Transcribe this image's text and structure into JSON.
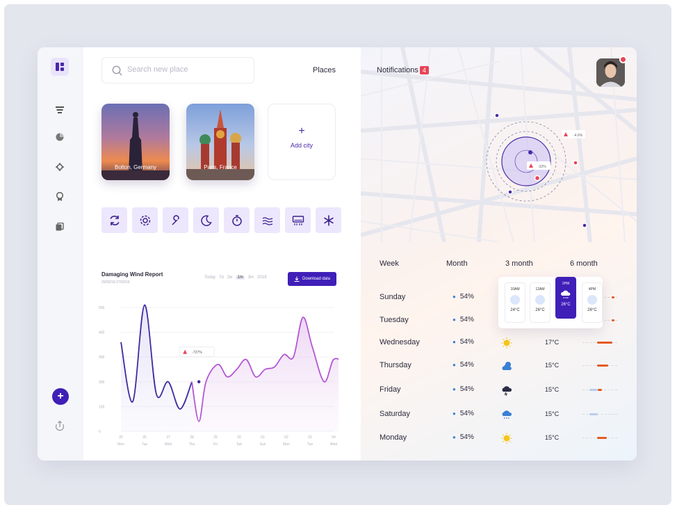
{
  "search": {
    "placeholder": "Search new place"
  },
  "header": {
    "places": "Places",
    "notifications": "Notifications",
    "notification_count": "4"
  },
  "cities": [
    {
      "label": "Bolton, Germany"
    },
    {
      "label": "Paris, France"
    }
  ],
  "add_city": {
    "plus": "+",
    "label": "Add city"
  },
  "tools": [
    "refresh-icon",
    "settings-icon",
    "wrench-icon",
    "moon-icon",
    "timer-icon",
    "wind-icon",
    "ac-icon",
    "snowflake-icon"
  ],
  "report": {
    "title": "Damaging Wind Report",
    "date": "20/02/19-27/02/19",
    "ranges": [
      "Today",
      "7d",
      "2w",
      "1m",
      "3m",
      "2019"
    ],
    "active_range": "1m",
    "download": "Download data"
  },
  "map_alerts": [
    "-4.6%",
    "-32%"
  ],
  "forecast": {
    "tabs": [
      "Week",
      "Month",
      "3 month",
      "6 month"
    ],
    "days": [
      {
        "day": "Sunday",
        "humidity": "54%",
        "icon": "",
        "temp": ""
      },
      {
        "day": "Tuesday",
        "humidity": "54%",
        "icon": "",
        "temp": ""
      },
      {
        "day": "Wednesday",
        "humidity": "54%",
        "icon": "sun-icon",
        "temp": "17°C"
      },
      {
        "day": "Thursday",
        "humidity": "54%",
        "icon": "cloud-sun-icon",
        "temp": "15°C"
      },
      {
        "day": "Friday",
        "humidity": "54%",
        "icon": "storm-icon",
        "temp": "15°C"
      },
      {
        "day": "Saturday",
        "humidity": "54%",
        "icon": "rain-icon",
        "temp": "15°C"
      },
      {
        "day": "Monday",
        "humidity": "54%",
        "icon": "sun-icon",
        "temp": "15°C"
      }
    ],
    "hourly": [
      {
        "time": "10AM",
        "temp": "24°C"
      },
      {
        "time": "12AM",
        "temp": "26°C"
      },
      {
        "time": "2PM",
        "temp": "26°C"
      },
      {
        "time": "4PM",
        "temp": "26°C"
      }
    ]
  },
  "chart_data": {
    "type": "line",
    "title": "Damaging Wind Report",
    "categories": [
      "25",
      "26",
      "27",
      "28",
      "29",
      "30",
      "01",
      "02",
      "03",
      "04"
    ],
    "weekdays": [
      "Mon",
      "Tue",
      "Wed",
      "Thu",
      "Fri",
      "Sat",
      "Sun",
      "Mon",
      "Tue",
      "Wed"
    ],
    "yticks": [
      0,
      100,
      200,
      300,
      400,
      500
    ],
    "ylim": [
      0,
      500
    ],
    "grid": true,
    "annotation": "-727%",
    "series": [
      {
        "x": [
          0,
          0.5,
          1,
          1.5,
          2,
          2.5,
          3
        ],
        "values": [
          360,
          120,
          510,
          150,
          200,
          90,
          200
        ]
      },
      {
        "x": [
          3,
          3.3,
          3.6,
          4.1,
          4.5,
          4.9,
          5.3,
          5.7,
          6.1,
          6.5,
          6.9,
          7.3,
          7.7,
          8.1,
          8.6,
          9,
          9.4,
          9.7
        ],
        "values": [
          200,
          40,
          200,
          270,
          220,
          250,
          290,
          220,
          250,
          260,
          310,
          300,
          460,
          340,
          200,
          290,
          260,
          100
        ]
      }
    ]
  },
  "colors": {
    "accent": "#3f1fb8",
    "alert": "#e94356",
    "orange": "#e55a1f"
  }
}
